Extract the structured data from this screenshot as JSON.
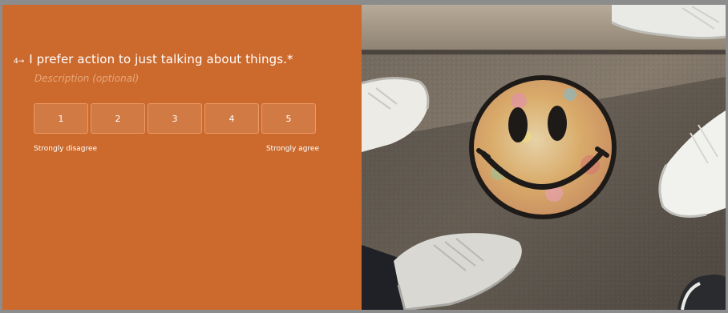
{
  "question": {
    "number": "4",
    "arrow": "→",
    "text": "I prefer action to just talking about things.",
    "required_marker": "*",
    "description_placeholder": "Description (optional)"
  },
  "scale": {
    "options": [
      "1",
      "2",
      "3",
      "4",
      "5"
    ],
    "min_label": "Strongly disagree",
    "max_label": "Strongly agree"
  },
  "colors": {
    "background": "#cc6a2d",
    "button_fill": "#d27a44",
    "button_border": "#ea9a6a",
    "description_text": "#e7a77a"
  },
  "image": {
    "subject": "smiley-face-graffiti-with-sneakers"
  }
}
